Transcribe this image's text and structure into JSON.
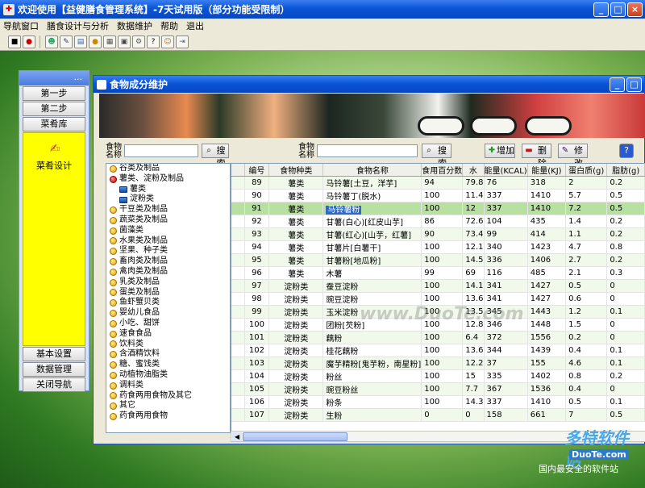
{
  "app": {
    "title": "欢迎使用【益健膳食管理系统】-7天试用版（部分功能受限制）"
  },
  "window_buttons": [
    "_",
    "□",
    "×"
  ],
  "menu": [
    "导航窗口",
    "膳食设计与分析",
    "数据维护",
    "帮助",
    "退出"
  ],
  "toolbar_icons": [
    "save-icon",
    "stop-icon",
    "users-icon",
    "edit-icon",
    "window-icon",
    "apple-icon",
    "building-icon",
    "database-icon",
    "gear-icon",
    "help-icon",
    "people-icon",
    "exit-icon"
  ],
  "nav": {
    "header": "...",
    "top_buttons": [
      "第一步",
      "第二步",
      "菜肴库"
    ],
    "selected": {
      "icon": "pen-icon",
      "label": "菜肴设计"
    },
    "bottom_buttons": [
      "基本设置",
      "数据管理",
      "关闭导航"
    ]
  },
  "window": {
    "title": "食物成分维护"
  },
  "search": {
    "left_label": "食物名称",
    "left_button": "搜索",
    "right_label": "食物名称",
    "right_button": "搜索",
    "add": "增加",
    "delete": "删除",
    "modify": "修改",
    "help": "?"
  },
  "tree": [
    {
      "label": "谷类及制品",
      "open": false,
      "child": false
    },
    {
      "label": "薯类、淀粉及制品",
      "open": true,
      "child": false
    },
    {
      "label": "薯类",
      "open": false,
      "child": true
    },
    {
      "label": "淀粉类",
      "open": false,
      "child": true
    },
    {
      "label": "干豆类及制品",
      "open": false,
      "child": false
    },
    {
      "label": "蔬菜类及制品",
      "open": false,
      "child": false
    },
    {
      "label": "菌藻类",
      "open": false,
      "child": false
    },
    {
      "label": "水果类及制品",
      "open": false,
      "child": false
    },
    {
      "label": "坚果、种子类",
      "open": false,
      "child": false
    },
    {
      "label": "畜肉类及制品",
      "open": false,
      "child": false
    },
    {
      "label": "禽肉类及制品",
      "open": false,
      "child": false
    },
    {
      "label": "乳类及制品",
      "open": false,
      "child": false
    },
    {
      "label": "蛋类及制品",
      "open": false,
      "child": false
    },
    {
      "label": "鱼虾蟹贝类",
      "open": false,
      "child": false
    },
    {
      "label": "婴幼儿食品",
      "open": false,
      "child": false
    },
    {
      "label": "小吃、甜饼",
      "open": false,
      "child": false
    },
    {
      "label": "速食食品",
      "open": false,
      "child": false
    },
    {
      "label": "饮料类",
      "open": false,
      "child": false
    },
    {
      "label": "含酒精饮料",
      "open": false,
      "child": false
    },
    {
      "label": "糖、蜜饯类",
      "open": false,
      "child": false
    },
    {
      "label": "动植物油脂类",
      "open": false,
      "child": false
    },
    {
      "label": "调料类",
      "open": false,
      "child": false
    },
    {
      "label": "药食两用食物及其它",
      "open": false,
      "child": false
    },
    {
      "label": "其它",
      "open": false,
      "child": false
    },
    {
      "label": "药食两用食物",
      "open": false,
      "child": false
    }
  ],
  "table": {
    "columns": [
      "编号",
      "食物种类",
      "食物名称",
      "食用百分数",
      "水",
      "能量(KCAL)",
      "能量(KJ)",
      "蛋白质(g)",
      "脂肪(g)"
    ],
    "selected_row": 2,
    "rows": [
      [
        "89",
        "薯类",
        "马铃薯[土豆，洋芋]",
        "94",
        "79.8",
        "76",
        "318",
        "2",
        "0.2"
      ],
      [
        "90",
        "薯类",
        "马铃薯丁(脱水)",
        "100",
        "11.4",
        "337",
        "1410",
        "5.7",
        "0.5"
      ],
      [
        "91",
        "薯类",
        "马铃薯粉",
        "100",
        "12",
        "337",
        "1410",
        "7.2",
        "0.5"
      ],
      [
        "92",
        "薯类",
        "甘薯(白心)[红皮山芋]",
        "86",
        "72.6",
        "104",
        "435",
        "1.4",
        "0.2"
      ],
      [
        "93",
        "薯类",
        "甘薯(红心)[山芋，红薯]",
        "90",
        "73.4",
        "99",
        "414",
        "1.1",
        "0.2"
      ],
      [
        "94",
        "薯类",
        "甘薯片[白薯干]",
        "100",
        "12.1",
        "340",
        "1423",
        "4.7",
        "0.8"
      ],
      [
        "95",
        "薯类",
        "甘薯粉[地瓜粉]",
        "100",
        "14.5",
        "336",
        "1406",
        "2.7",
        "0.2"
      ],
      [
        "96",
        "薯类",
        "木薯",
        "99",
        "69",
        "116",
        "485",
        "2.1",
        "0.3"
      ],
      [
        "97",
        "淀粉类",
        "蚕豆淀粉",
        "100",
        "14.1",
        "341",
        "1427",
        "0.5",
        "0"
      ],
      [
        "98",
        "淀粉类",
        "豌豆淀粉",
        "100",
        "13.6",
        "341",
        "1427",
        "0.6",
        "0"
      ],
      [
        "99",
        "淀粉类",
        "玉米淀粉",
        "100",
        "13.5",
        "345",
        "1443",
        "1.2",
        "0.1"
      ],
      [
        "100",
        "淀粉类",
        "团粉[芡粉]",
        "100",
        "12.8",
        "346",
        "1448",
        "1.5",
        "0"
      ],
      [
        "101",
        "淀粉类",
        "藕粉",
        "100",
        "6.4",
        "372",
        "1556",
        "0.2",
        "0"
      ],
      [
        "102",
        "淀粉类",
        "桂花藕粉",
        "100",
        "13.6",
        "344",
        "1439",
        "0.4",
        "0.1"
      ],
      [
        "103",
        "淀粉类",
        "魔芋精粉[鬼芋粉，南星粉]",
        "100",
        "12.2",
        "37",
        "155",
        "4.6",
        "0.1"
      ],
      [
        "104",
        "淀粉类",
        "粉丝",
        "100",
        "15",
        "335",
        "1402",
        "0.8",
        "0.2"
      ],
      [
        "105",
        "淀粉类",
        "豌豆粉丝",
        "100",
        "7.7",
        "367",
        "1536",
        "0.4",
        "0"
      ],
      [
        "106",
        "淀粉类",
        "粉条",
        "100",
        "14.3",
        "337",
        "1410",
        "0.5",
        "0.1"
      ],
      [
        "107",
        "淀粉类",
        "生粉",
        "0",
        "0",
        "158",
        "661",
        "7",
        "0.5"
      ]
    ]
  },
  "watermark": "www.DuoTe.com",
  "brand": {
    "logo": "多特软件站",
    "site": "DuoTe.com",
    "slogan": "国内最安全的软件站"
  }
}
